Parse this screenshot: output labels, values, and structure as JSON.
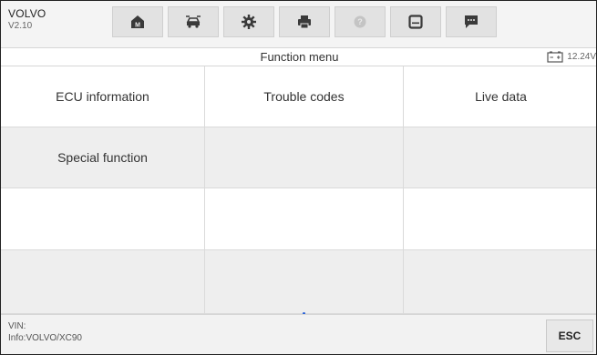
{
  "toolbar": {
    "brand": "VOLVO",
    "version": "V2.10",
    "buttons": [
      {
        "icon": "home-icon"
      },
      {
        "icon": "vehicle-swap-icon"
      },
      {
        "icon": "gear-icon"
      },
      {
        "icon": "printer-icon"
      },
      {
        "icon": "help-icon"
      },
      {
        "icon": "save-icon"
      },
      {
        "icon": "message-icon"
      }
    ]
  },
  "titlebar": {
    "title": "Function menu",
    "battery_icon": "battery-icon",
    "voltage": "12.24V"
  },
  "menu": {
    "rows": [
      [
        "ECU information",
        "Trouble codes",
        "Live data"
      ],
      [
        "Special function",
        "",
        ""
      ],
      [
        "",
        "",
        ""
      ],
      [
        "",
        "",
        ""
      ]
    ]
  },
  "footer": {
    "vin_label": "VIN:",
    "info": "Info:VOLVO/XC90",
    "esc_label": "ESC"
  },
  "colors": {
    "toolbar_bg": "#f4f4f4",
    "row_alt_bg": "#eeeeee",
    "indicator": "#2a62d8"
  }
}
